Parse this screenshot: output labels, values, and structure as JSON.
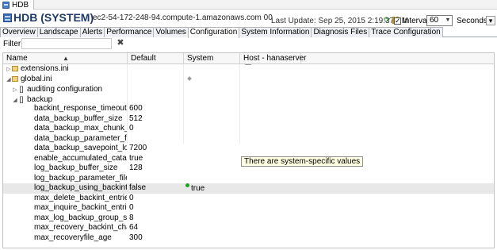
{
  "window_tab": {
    "label": "HDB"
  },
  "header": {
    "title": "HDB (SYSTEM)",
    "host": "ec2-54-172-248-94.compute-1.amazonaws.com 00",
    "last_update": "Last Update:  Sep 25, 2015 2:19:37 PM",
    "interval_label": "Interval:",
    "interval_value": "60",
    "seconds_label": "Seconds"
  },
  "tabs": [
    {
      "label": "Overview"
    },
    {
      "label": "Landscape"
    },
    {
      "label": "Alerts"
    },
    {
      "label": "Performance"
    },
    {
      "label": "Volumes"
    },
    {
      "label": "Configuration",
      "active": true
    },
    {
      "label": "System Information"
    },
    {
      "label": "Diagnosis Files"
    },
    {
      "label": "Trace Configuration"
    }
  ],
  "filter": {
    "label": "Filter:",
    "value": ""
  },
  "table": {
    "columns": [
      "Name",
      "Default",
      "System",
      "Host - hanaserver"
    ],
    "rows": [
      {
        "name": "extensions.ini",
        "default": "",
        "system": "",
        "host": ""
      },
      {
        "name": "global.ini",
        "default": "",
        "system": "",
        "host": ""
      },
      {
        "name": "auditing configuration",
        "default": "",
        "system": "",
        "host": ""
      },
      {
        "name": "backup",
        "default": "",
        "system": "",
        "host": ""
      },
      {
        "name": "backint_response_timeout",
        "default": "600",
        "system": "",
        "host": ""
      },
      {
        "name": "data_backup_buffer_size",
        "default": "512",
        "system": "",
        "host": ""
      },
      {
        "name": "data_backup_max_chunk_size",
        "default": "0",
        "system": "",
        "host": ""
      },
      {
        "name": "data_backup_parameter_file",
        "default": "",
        "system": "",
        "host": ""
      },
      {
        "name": "data_backup_savepoint_lock_tim",
        "default": "7200",
        "system": "",
        "host": ""
      },
      {
        "name": "enable_accumulated_catalog_bac",
        "default": "true",
        "system": "",
        "host": ""
      },
      {
        "name": "log_backup_buffer_size",
        "default": "128",
        "system": "",
        "host": ""
      },
      {
        "name": "log_backup_parameter_file",
        "default": "",
        "system": "",
        "host": ""
      },
      {
        "name": "log_backup_using_backint",
        "default": "false",
        "system": "true",
        "host": ""
      },
      {
        "name": "max_delete_backint_entries",
        "default": "0",
        "system": "",
        "host": ""
      },
      {
        "name": "max_inquire_backint_entries",
        "default": "0",
        "system": "",
        "host": ""
      },
      {
        "name": "max_log_backup_group_size",
        "default": "8",
        "system": "",
        "host": ""
      },
      {
        "name": "max_recovery_backint_channels",
        "default": "64",
        "system": "",
        "host": ""
      },
      {
        "name": "max_recoveryfile_age",
        "default": "300",
        "system": "",
        "host": ""
      }
    ]
  },
  "tooltip": {
    "text": "There are system-specific values"
  }
}
